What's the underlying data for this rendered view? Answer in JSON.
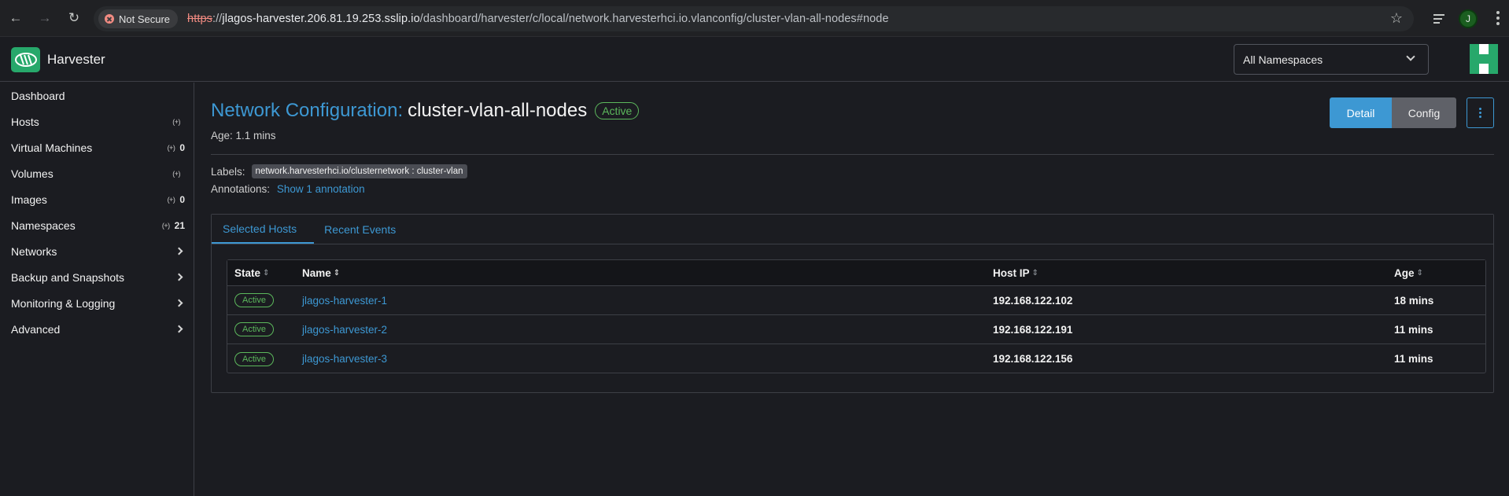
{
  "browser": {
    "security_label": "Not Secure",
    "url_scheme": "https",
    "url_sep": "://",
    "url_host": "jlagos-harvester.206.81.19.253.sslip.io",
    "url_path": "/dashboard/harvester/c/local/network.harvesterhci.io.vlanconfig/cluster-vlan-all-nodes#node",
    "profile_initial": "J"
  },
  "header": {
    "brand": "Harvester",
    "namespace_select": "All Namespaces"
  },
  "sidebar": {
    "items": [
      {
        "label": "Dashboard",
        "count": ""
      },
      {
        "label": "Hosts",
        "count": ""
      },
      {
        "label": "Virtual Machines",
        "count": "0"
      },
      {
        "label": "Volumes",
        "count": ""
      },
      {
        "label": "Images",
        "count": "0"
      },
      {
        "label": "Namespaces",
        "count": "21"
      },
      {
        "label": "Networks"
      },
      {
        "label": "Backup and Snapshots"
      },
      {
        "label": "Monitoring & Logging"
      },
      {
        "label": "Advanced"
      }
    ],
    "ns_marker": "(+)"
  },
  "main": {
    "title_prefix": "Network Configuration:",
    "title_name": "cluster-vlan-all-nodes",
    "state": "Active",
    "age": "Age: 1.1 mins",
    "btn_detail": "Detail",
    "btn_config": "Config",
    "labels_title": "Labels:",
    "label_chip": "network.harvesterhci.io/clusternetwork : cluster-vlan",
    "annotations_title": "Annotations:",
    "annotations_link": "Show 1 annotation",
    "tabs": [
      {
        "label": "Selected Hosts"
      },
      {
        "label": "Recent Events"
      }
    ],
    "table": {
      "headers": {
        "state": "State",
        "name": "Name",
        "ip": "Host IP",
        "age": "Age"
      },
      "rows": [
        {
          "state": "Active",
          "name": "jlagos-harvester-1",
          "ip": "192.168.122.102",
          "age": "18 mins"
        },
        {
          "state": "Active",
          "name": "jlagos-harvester-2",
          "ip": "192.168.122.191",
          "age": "11 mins"
        },
        {
          "state": "Active",
          "name": "jlagos-harvester-3",
          "ip": "192.168.122.156",
          "age": "11 mins"
        }
      ]
    }
  },
  "colors": {
    "accent": "#3d98d3",
    "success": "#5cb85c",
    "brand": "#27a86b",
    "background": "#1b1c21"
  }
}
